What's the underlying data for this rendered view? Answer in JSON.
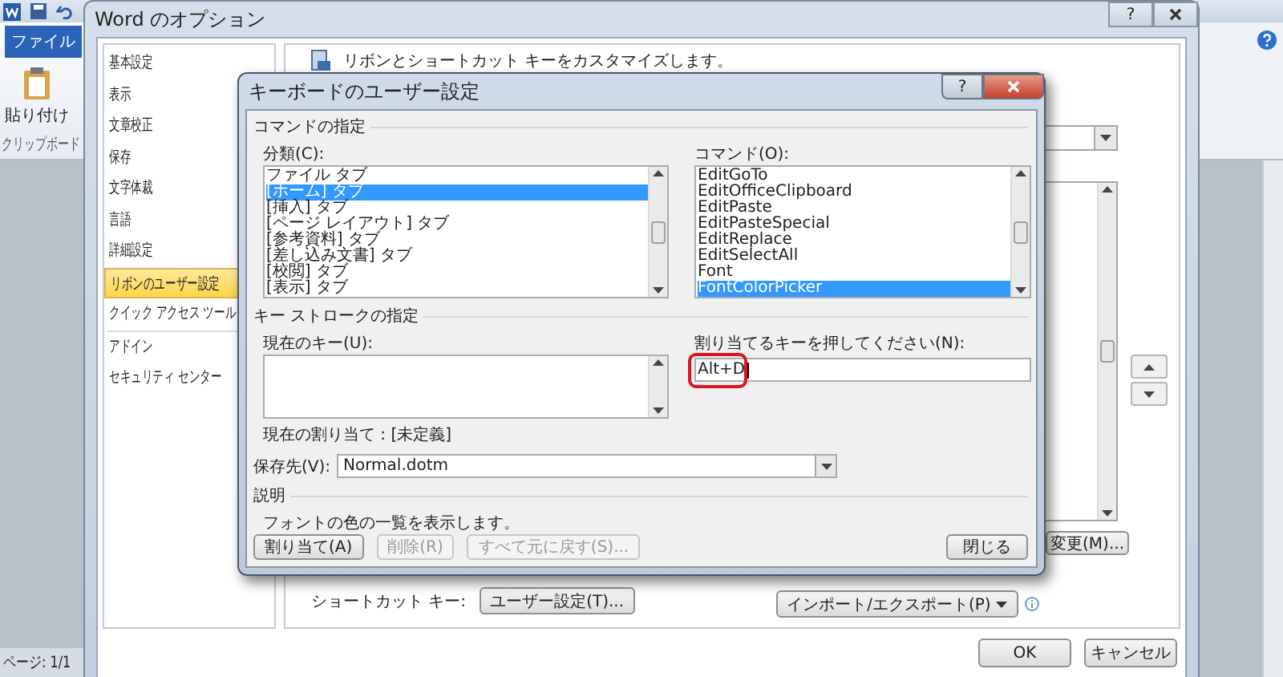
{
  "word_app": {
    "file_tab": "ファイル",
    "paste_label": "貼り付け",
    "clipboard_group": "クリップボード",
    "status_page": "ページ: 1/1"
  },
  "options_dialog": {
    "title": "Word のオプション",
    "help_button": "?",
    "nav": [
      {
        "label": "基本設定",
        "selected": false
      },
      {
        "label": "表示",
        "selected": false
      },
      {
        "label": "文章校正",
        "selected": false
      },
      {
        "label": "保存",
        "selected": false
      },
      {
        "label": "文字体裁",
        "selected": false
      },
      {
        "label": "言語",
        "selected": false
      },
      {
        "label": "詳細設定",
        "selected": false
      },
      {
        "label": "リボンのユーザー設定",
        "selected": true
      },
      {
        "label": "クイック アクセス ツール",
        "selected": false
      },
      {
        "label": "アドイン",
        "selected": false
      },
      {
        "label": "セキュリティ センター",
        "selected": false
      }
    ],
    "heading": "リボンとショートカット キーをカスタマイズします。",
    "modify_button": "変更(M)...",
    "shortcut_label": "ショートカット キー:",
    "customize_button": "ユーザー設定(T)...",
    "import_export_button": "インポート/エクスポート(P)",
    "ok_button": "OK",
    "cancel_button": "キャンセル"
  },
  "keyboard_dialog": {
    "title": "キーボードのユーザー設定",
    "help_button": "?",
    "command_group": "コマンドの指定",
    "categories_label": "分類(C):",
    "categories": [
      {
        "label": "ファイル タブ",
        "selected": false
      },
      {
        "label": "[ホーム] タブ",
        "selected": true
      },
      {
        "label": "[挿入] タブ",
        "selected": false
      },
      {
        "label": "[ページ レイアウト] タブ",
        "selected": false
      },
      {
        "label": "[参考資料] タブ",
        "selected": false
      },
      {
        "label": "[差し込み文書] タブ",
        "selected": false
      },
      {
        "label": "[校閲] タブ",
        "selected": false
      },
      {
        "label": "[表示] タブ",
        "selected": false
      }
    ],
    "commands_label": "コマンド(O):",
    "commands": [
      {
        "label": "EditGoTo",
        "selected": false
      },
      {
        "label": "EditOfficeClipboard",
        "selected": false
      },
      {
        "label": "EditPaste",
        "selected": false
      },
      {
        "label": "EditPasteSpecial",
        "selected": false
      },
      {
        "label": "EditReplace",
        "selected": false
      },
      {
        "label": "EditSelectAll",
        "selected": false
      },
      {
        "label": "Font",
        "selected": false
      },
      {
        "label": "FontColorPicker",
        "selected": true
      }
    ],
    "keystroke_group": "キー ストロークの指定",
    "current_keys_label": "現在のキー(U):",
    "new_key_label": "割り当てるキーを押してください(N):",
    "new_key": {
      "value": "Alt+D",
      "highlighted": true
    },
    "current_assignment": "現在の割り当て : [未定義]",
    "save_in_label": "保存先(V):",
    "save_in_value": "Normal.dotm",
    "description_group": "説明",
    "description": "フォントの色の一覧を表示します。",
    "buttons": [
      {
        "label": "割り当て(A)",
        "disabled": false
      },
      {
        "label": "削除(R)",
        "disabled": true
      },
      {
        "label": "すべて元に戻す(S)...",
        "disabled": true
      }
    ],
    "close_button": "閉じる"
  }
}
